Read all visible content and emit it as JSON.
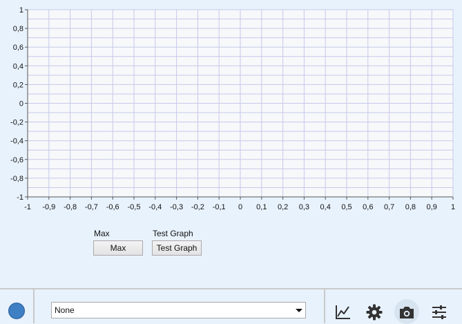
{
  "chart_data": {
    "type": "line",
    "series": [],
    "x_ticks": [
      "-1",
      "-0,9",
      "-0,8",
      "-0,7",
      "-0,6",
      "-0,5",
      "-0,4",
      "-0,3",
      "-0,2",
      "-0,1",
      "0",
      "0,1",
      "0,2",
      "0,3",
      "0,4",
      "0,5",
      "0,6",
      "0,7",
      "0,8",
      "0,9",
      "1"
    ],
    "y_ticks": [
      "1",
      "0,8",
      "0,6",
      "0,4",
      "0,2",
      "0",
      "-0,2",
      "-0,4",
      "-0,6",
      "-0,8",
      "-1"
    ],
    "xlim": [
      -1,
      1
    ],
    "ylim": [
      -1,
      1
    ],
    "grid": true,
    "x_grid_step": 0.1,
    "y_grid_step": 0.1,
    "colors": {
      "plot_background": "#f6f8fa",
      "grid": "#c6c9ea",
      "axis": "#555555"
    }
  },
  "controls": {
    "max_label": "Max",
    "max_button": "Max",
    "test_graph_label": "Test Graph",
    "test_graph_button": "Test Graph"
  },
  "bottom_bar": {
    "series_color": "#3f7fc3",
    "series_select_value": "None",
    "icons": [
      "line-chart-icon",
      "gear-icon",
      "camera-icon",
      "sliders-icon"
    ]
  }
}
